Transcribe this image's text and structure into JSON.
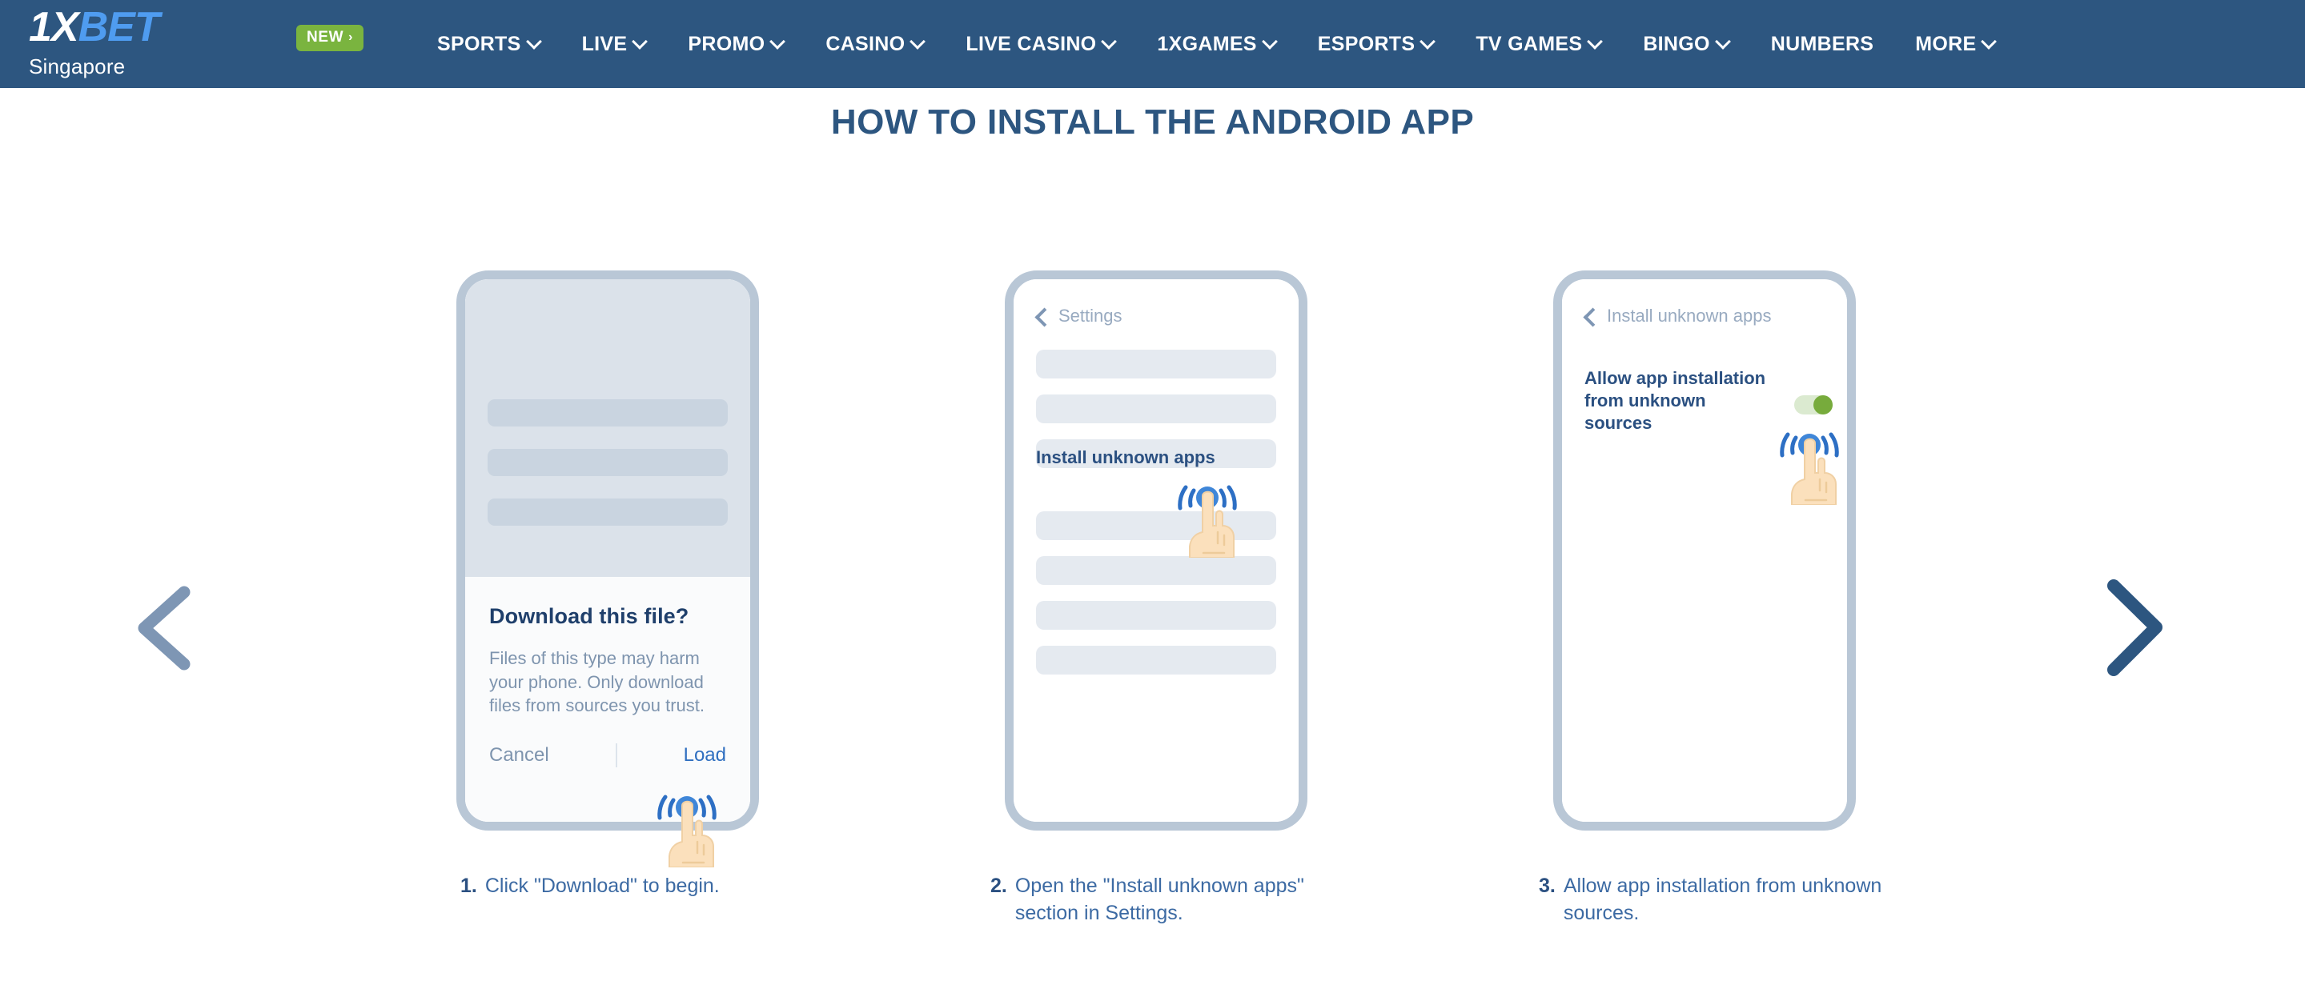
{
  "header": {
    "logo": {
      "part1": "1",
      "part2": "X",
      "part3": "BET"
    },
    "country": "Singapore",
    "new_badge": {
      "label": "NEW",
      "chevron": "›"
    },
    "nav_items": [
      {
        "label": "SPORTS",
        "has_caret": true
      },
      {
        "label": "LIVE",
        "has_caret": true
      },
      {
        "label": "PROMO",
        "has_caret": true
      },
      {
        "label": "CASINO",
        "has_caret": true
      },
      {
        "label": "LIVE CASINO",
        "has_caret": true
      },
      {
        "label": "1XGAMES",
        "has_caret": true
      },
      {
        "label": "ESPORTS",
        "has_caret": true
      },
      {
        "label": "TV GAMES",
        "has_caret": true
      },
      {
        "label": "BINGO",
        "has_caret": true
      },
      {
        "label": "NUMBERS",
        "has_caret": false
      },
      {
        "label": "MORE",
        "has_caret": true
      }
    ],
    "bg_color": "#2d5680",
    "accent_green": "#7ab43f",
    "logo_blue": "#4f9cf0"
  },
  "page": {
    "title": "HOW TO INSTALL THE ANDROID APP",
    "title_color": "#2d5680"
  },
  "carousel": {
    "prev_label": "Previous slide",
    "next_label": "Next slide",
    "prev_color": "#7e96b4",
    "next_color": "#2d5680"
  },
  "steps": [
    {
      "number": "1.",
      "caption": "Click \"Download\" to begin.",
      "screen": {
        "dialog_title": "Download this file?",
        "dialog_body": "Files of this type may harm your phone. Only download files from sources you trust.",
        "cancel_label": "Cancel",
        "confirm_label": "Load"
      }
    },
    {
      "number": "2.",
      "caption": "Open the \"Install unknown apps\" section in Settings.",
      "screen": {
        "header_label": "Settings",
        "item_label": "Install unknown apps"
      }
    },
    {
      "number": "3.",
      "caption": "Allow app installation from unknown sources.",
      "screen": {
        "header_label": "Install unknown apps",
        "item_label": "Allow app installation from unknown sources",
        "toggle_state": "on",
        "toggle_color": "#77ab3c"
      }
    }
  ]
}
